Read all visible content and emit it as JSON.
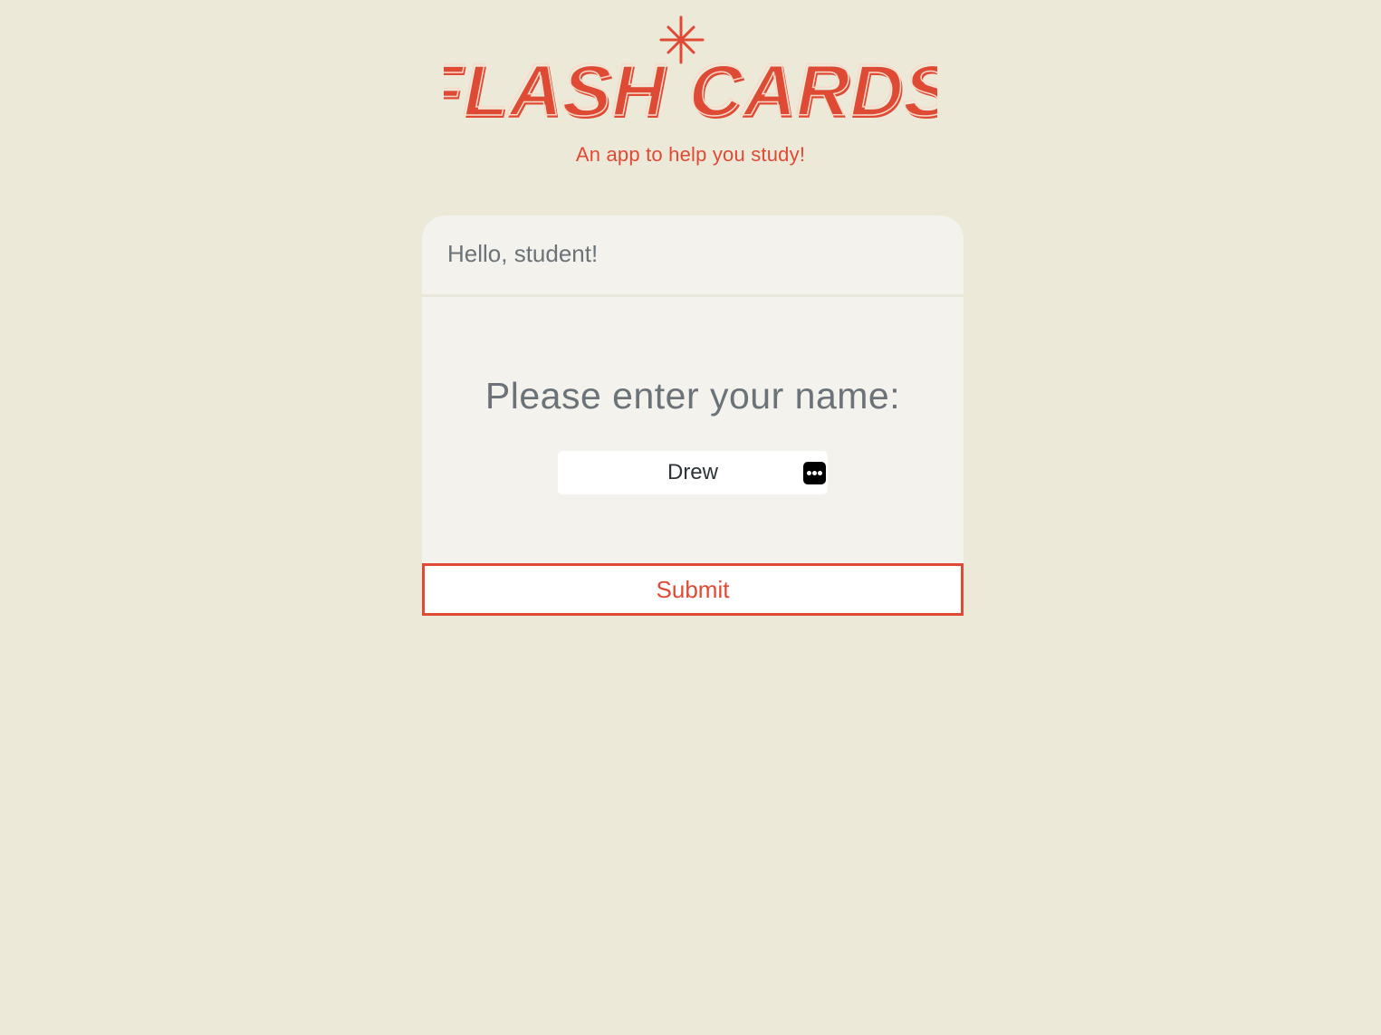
{
  "logo": {
    "text": "FLASH CARDS",
    "left_word": "FLASH",
    "right_word": "CARDS",
    "color": "#df4a35"
  },
  "tagline": "An app to help you study!",
  "card": {
    "header": "Hello, student!",
    "prompt": "Please enter your name:",
    "name_input": {
      "value": "Drew",
      "autofill_icon": "ellipsis-autofill-icon"
    },
    "submit_label": "Submit"
  },
  "colors": {
    "background": "#ede9d9",
    "card": "#f3f2ec",
    "accent": "#df4a35",
    "muted_text": "#6b7378"
  }
}
